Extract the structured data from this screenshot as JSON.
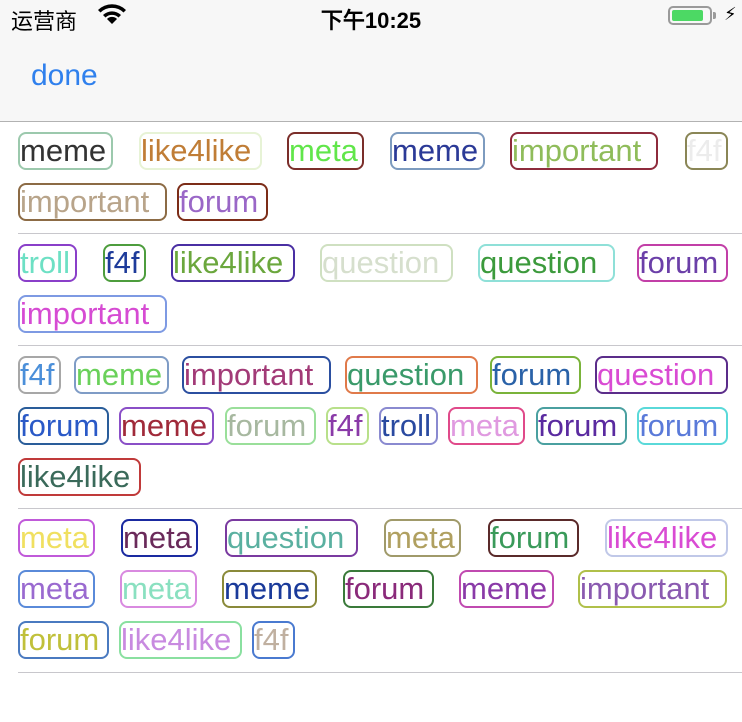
{
  "status_bar": {
    "carrier": "运营商",
    "time": "下午10:25",
    "battery_level": 0.85,
    "icons": [
      "wifi-icon",
      "battery-icon",
      "charging-icon"
    ],
    "charging_glyph": "⚡"
  },
  "nav": {
    "done_label": "done"
  },
  "sections": [
    {
      "tags": [
        {
          "text": "meme",
          "color": "#333333",
          "border": "#9cc9ad"
        },
        {
          "text": "like4like",
          "color": "#c07d36",
          "border": "#e7f3d6"
        },
        {
          "text": "meta",
          "color": "#61e64a",
          "border": "#7b2e2a"
        },
        {
          "text": "meme",
          "color": "#2b3a97",
          "border": "#7d9bbf"
        },
        {
          "text": "important",
          "color": "#8fbc5a",
          "border": "#8e2b3c"
        },
        {
          "text": "f4f",
          "color": "#ececec",
          "border": "#8a8656"
        },
        {
          "text": "important",
          "color": "#b8a48a",
          "border": "#8c6b45"
        },
        {
          "text": "forum",
          "color": "#9a67c7",
          "border": "#7c2d18"
        }
      ]
    },
    {
      "tags": [
        {
          "text": "troll",
          "color": "#6de0c4",
          "border": "#8a3fc9"
        },
        {
          "text": "f4f",
          "color": "#1e3b9a",
          "border": "#4d9d3d"
        },
        {
          "text": "like4like",
          "color": "#6ba73d",
          "border": "#4a2fa3"
        },
        {
          "text": "question",
          "color": "#d6dfcd",
          "border": "#cfe0c1"
        },
        {
          "text": "question",
          "color": "#3c9a3c",
          "border": "#8fe0d8"
        },
        {
          "text": "forum",
          "color": "#6b3fa8",
          "border": "#c23fa7"
        },
        {
          "text": "important",
          "color": "#d64bd3",
          "border": "#7e9ae3"
        }
      ]
    },
    {
      "tags": [
        {
          "text": "f4f",
          "color": "#4b8fd9",
          "border": "#a7a7a7"
        },
        {
          "text": "meme",
          "color": "#6ad15a",
          "border": "#7f9cc6"
        },
        {
          "text": "important",
          "color": "#a23a77",
          "border": "#2b4fa0"
        },
        {
          "text": "question",
          "color": "#3a9a6a",
          "border": "#e07a4a"
        },
        {
          "text": "forum",
          "color": "#2a62a8",
          "border": "#7ab33a"
        },
        {
          "text": "question",
          "color": "#d94bd3",
          "border": "#5b2d8a"
        },
        {
          "text": "forum",
          "color": "#2a59c7",
          "border": "#2a5d9a"
        },
        {
          "text": "meme",
          "color": "#a02a3a",
          "border": "#8a4fc7"
        },
        {
          "text": "forum",
          "color": "#a7b8a0",
          "border": "#9adf9a"
        },
        {
          "text": "f4f",
          "color": "#8a3aa8",
          "border": "#b8e08a"
        },
        {
          "text": "troll",
          "color": "#2a4aa0",
          "border": "#8a8ad0"
        },
        {
          "text": "meta",
          "color": "#e09ae0",
          "border": "#e04a8a"
        },
        {
          "text": "forum",
          "color": "#5a2aa0",
          "border": "#4aa0a0"
        },
        {
          "text": "forum",
          "color": "#5a7ad9",
          "border": "#5ad9d9"
        },
        {
          "text": "like4like",
          "color": "#3a6a5a",
          "border": "#c03a3a"
        }
      ]
    },
    {
      "tags": [
        {
          "text": "meta",
          "color": "#f0e060",
          "border": "#c05ad9"
        },
        {
          "text": "meta",
          "color": "#6a2a5a",
          "border": "#1a2aa0"
        },
        {
          "text": "question",
          "color": "#5ab0a0",
          "border": "#7a3aa0"
        },
        {
          "text": "meta",
          "color": "#b0a060",
          "border": "#a09a6a"
        },
        {
          "text": "forum",
          "color": "#3a9a5a",
          "border": "#5a2a2a"
        },
        {
          "text": "like4like",
          "color": "#d94bd3",
          "border": "#c0c8e8"
        },
        {
          "text": "meta",
          "color": "#9a6ad0",
          "border": "#5a8ad9"
        },
        {
          "text": "meta",
          "color": "#8ae0c0",
          "border": "#d98ae0"
        },
        {
          "text": "meme",
          "color": "#1a3a9a",
          "border": "#8a8a3a"
        },
        {
          "text": "forum",
          "color": "#8a2a7a",
          "border": "#3a7a3a"
        },
        {
          "text": "meme",
          "color": "#8a3aa8",
          "border": "#c04ab0"
        },
        {
          "text": "important",
          "color": "#8a5ab0",
          "border": "#b0c04a"
        },
        {
          "text": "forum",
          "color": "#c0c03a",
          "border": "#4a7ac0"
        },
        {
          "text": "like4like",
          "color": "#c88ae0",
          "border": "#8ae0a0"
        },
        {
          "text": "f4f",
          "color": "#c0b0a0",
          "border": "#4a7ad0"
        }
      ]
    }
  ]
}
